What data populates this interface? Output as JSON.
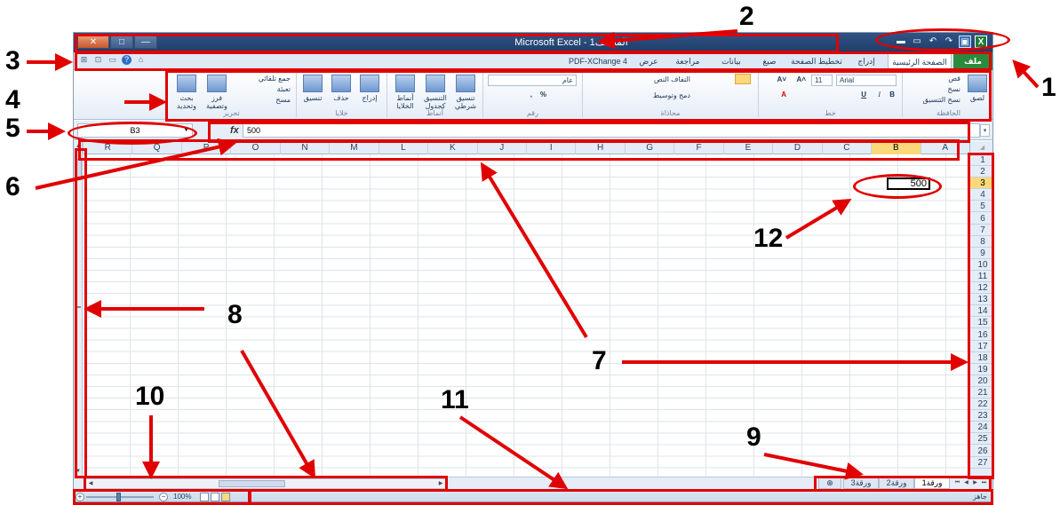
{
  "callouts": [
    "1",
    "2",
    "3",
    "4",
    "5",
    "6",
    "7",
    "8",
    "9",
    "10",
    "11",
    "12"
  ],
  "window": {
    "title": "Microsoft Excel - المصنف1",
    "controls": [
      "✕",
      "□",
      "—"
    ]
  },
  "qat": {
    "icons": [
      "folder-open-icon",
      "new-file-icon",
      "undo-icon",
      "redo-icon",
      "save-icon",
      "excel-logo-icon"
    ],
    "glyphs": [
      "▬",
      "▭",
      "↶",
      "↷",
      "▣",
      "X"
    ]
  },
  "tabs": [
    {
      "label": "ملف",
      "active": false,
      "file": true
    },
    {
      "label": "الصفحة الرئيسية",
      "active": true
    },
    {
      "label": "إدراج"
    },
    {
      "label": "تخطيط الصفحة"
    },
    {
      "label": "صيغ"
    },
    {
      "label": "بيانات"
    },
    {
      "label": "مراجعة"
    },
    {
      "label": "عرض"
    },
    {
      "label": "PDF-XChange 4"
    }
  ],
  "tab_mini_icons": [
    "⊠",
    "⊡",
    "▭",
    "?",
    "⌂"
  ],
  "ribbon": {
    "clipboard": {
      "paste": "لصق",
      "cut": "قص",
      "copy": "نسخ",
      "format_painter": "نسخ التنسيق",
      "label": "الحافظة"
    },
    "font": {
      "name": "Arial",
      "size": "11",
      "bold": "B",
      "italic": "I",
      "underline": "U",
      "grow": "A˄",
      "shrink": "A˅",
      "color": "A",
      "label": "خط"
    },
    "alignment": {
      "wrap": "التفاف النص",
      "merge": "دمج وتوسيط",
      "label": "محاذاة"
    },
    "number": {
      "format": "عام",
      "percent": "%",
      "comma": ",",
      "label": "رقم"
    },
    "styles": {
      "conditional": "تنسيق شرطي",
      "table": "التنسيق كجدول",
      "cell_styles": "أنماط الخلايا",
      "label": "أنماط"
    },
    "cells": {
      "insert": "إدراج",
      "delete": "حذف",
      "format": "تنسيق",
      "label": "خلايا"
    },
    "editing": {
      "autosum": "جمع تلقائي",
      "fill": "تعبئة",
      "clear": "مسح",
      "sort_filter": "فرز وتصفية",
      "find_select": "بحث وتحديد",
      "label": "تحرير"
    }
  },
  "formula_bar": {
    "name_box": "B3",
    "fx": "fx",
    "value": "500"
  },
  "columns": [
    {
      "label": "R"
    },
    {
      "label": "Q"
    },
    {
      "label": "P"
    },
    {
      "label": "O"
    },
    {
      "label": "N"
    },
    {
      "label": "M"
    },
    {
      "label": "L"
    },
    {
      "label": "K"
    },
    {
      "label": "J"
    },
    {
      "label": "I"
    },
    {
      "label": "H"
    },
    {
      "label": "G"
    },
    {
      "label": "F"
    },
    {
      "label": "E"
    },
    {
      "label": "D"
    },
    {
      "label": "C"
    },
    {
      "label": "B",
      "selected": true
    },
    {
      "label": "A"
    }
  ],
  "rows": [
    "1",
    "2",
    "3",
    "4",
    "5",
    "6",
    "7",
    "8",
    "9",
    "10",
    "11",
    "12",
    "13",
    "14",
    "15",
    "16",
    "17",
    "18",
    "19",
    "20",
    "21",
    "22",
    "23",
    "24",
    "25",
    "26",
    "27"
  ],
  "selected_row": "3",
  "cell_b3": "500",
  "sheet_tabs": [
    {
      "label": "ورقة1",
      "active": true
    },
    {
      "label": "ورقة2"
    },
    {
      "label": "ورقة3"
    }
  ],
  "tab_nav": [
    "⏮",
    "◀",
    "▶",
    "⏭"
  ],
  "status": {
    "ready": "جاهز",
    "zoom": "100%",
    "zoom_minus": "−",
    "zoom_plus": "+"
  },
  "colors": {
    "highlight": "#e00000",
    "file_tab": "#2c8a3f",
    "selected_header": "#f9d97a",
    "title_bar": "#2f5486"
  }
}
